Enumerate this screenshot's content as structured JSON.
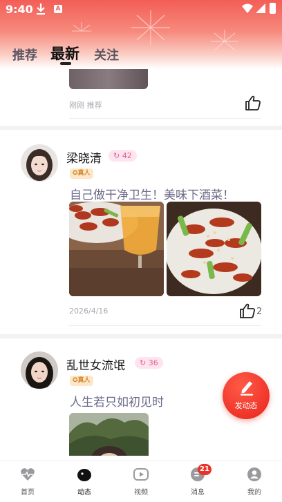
{
  "status_bar": {
    "time": "9:40",
    "download_icon": "download-icon",
    "notification_app_icon": "A"
  },
  "header": {
    "tabs": [
      {
        "label": "推荐",
        "active": false
      },
      {
        "label": "最新",
        "active": true
      },
      {
        "label": "关注",
        "active": false
      }
    ],
    "gradient_colors": [
      "#f35e57",
      "#f6897c",
      "#fbd0c7"
    ]
  },
  "feed": {
    "prev_post": {
      "date": "刚刚 推荐",
      "like_icon": "thumbs-up-icon"
    },
    "posts": [
      {
        "user": "梁晓清",
        "level": "42",
        "verified_badge": "真人",
        "text": "自己做干净卫生！美味下酒菜！",
        "date": "2026/4/16",
        "likes": "2"
      },
      {
        "user": "乱世女流氓",
        "level": "36",
        "verified_badge": "真人",
        "text": "人生若只如初见时"
      }
    ]
  },
  "fab": {
    "label": "发动态",
    "icon": "pen-icon",
    "color": "#e8231d"
  },
  "bottom_nav": {
    "items": [
      {
        "label": "首页",
        "icon": "heart-pulse-icon"
      },
      {
        "label": "动态",
        "icon": "bird-icon",
        "active": true
      },
      {
        "label": "视频",
        "icon": "video-icon"
      },
      {
        "label": "消息",
        "icon": "message-icon",
        "badge": "21"
      },
      {
        "label": "我的",
        "icon": "user-icon"
      }
    ],
    "badge_color": "#e8322a"
  }
}
